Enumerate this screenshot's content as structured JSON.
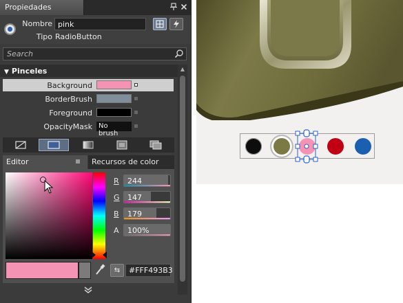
{
  "panel": {
    "title": "Propiedades",
    "pin_icon": "pin-icon",
    "close_icon": "close-icon"
  },
  "header": {
    "name_label": "Nombre",
    "name_value": "pink",
    "type_label": "Tipo",
    "type_value": "RadioButton"
  },
  "search": {
    "placeholder": "Search"
  },
  "brushes": {
    "section_title": "Pinceles",
    "rows": [
      {
        "label": "Background",
        "swatch": "#f493b3"
      },
      {
        "label": "BorderBrush",
        "swatch": "#7f8e9a"
      },
      {
        "label": "Foreground",
        "swatch": "#000000"
      },
      {
        "label": "OpacityMask",
        "value": "No brush"
      }
    ],
    "brush_types": [
      "no-brush-icon",
      "solid-brush-icon",
      "gradient-brush-icon",
      "tile-brush-icon",
      "brush-resources-icon"
    ],
    "selected_brush_type": 1
  },
  "editor": {
    "tab_editor": "Editor",
    "tab_resources": "Recursos de color",
    "channels": [
      {
        "label": "R",
        "value": "244",
        "level": 0.957,
        "strip": "linear-gradient(to right, #0093b3, #ff93b3)"
      },
      {
        "label": "G",
        "value": "147",
        "level": 0.576,
        "strip": "linear-gradient(to right, #f400b3, #f4ffb3)"
      },
      {
        "label": "B",
        "value": "179",
        "level": 0.702,
        "strip": "linear-gradient(to right, #f49300, #f493ff)"
      },
      {
        "label": "A",
        "value": "100%",
        "level": 1.0,
        "strip": "linear-gradient(to right, rgba(244,147,179,0), #f493b3)"
      }
    ],
    "current_color": "#f493b3",
    "hex_value": "#FFF493B3"
  },
  "design_surface": {
    "radio_buttons": [
      {
        "name": "black",
        "color": "#0d0d0d"
      },
      {
        "name": "olive",
        "color": "#7b7a44"
      },
      {
        "name": "pink",
        "color": "#f493b3",
        "selected": true
      },
      {
        "name": "red",
        "color": "#c10016"
      },
      {
        "name": "blue",
        "color": "#1a5fb0"
      }
    ]
  }
}
